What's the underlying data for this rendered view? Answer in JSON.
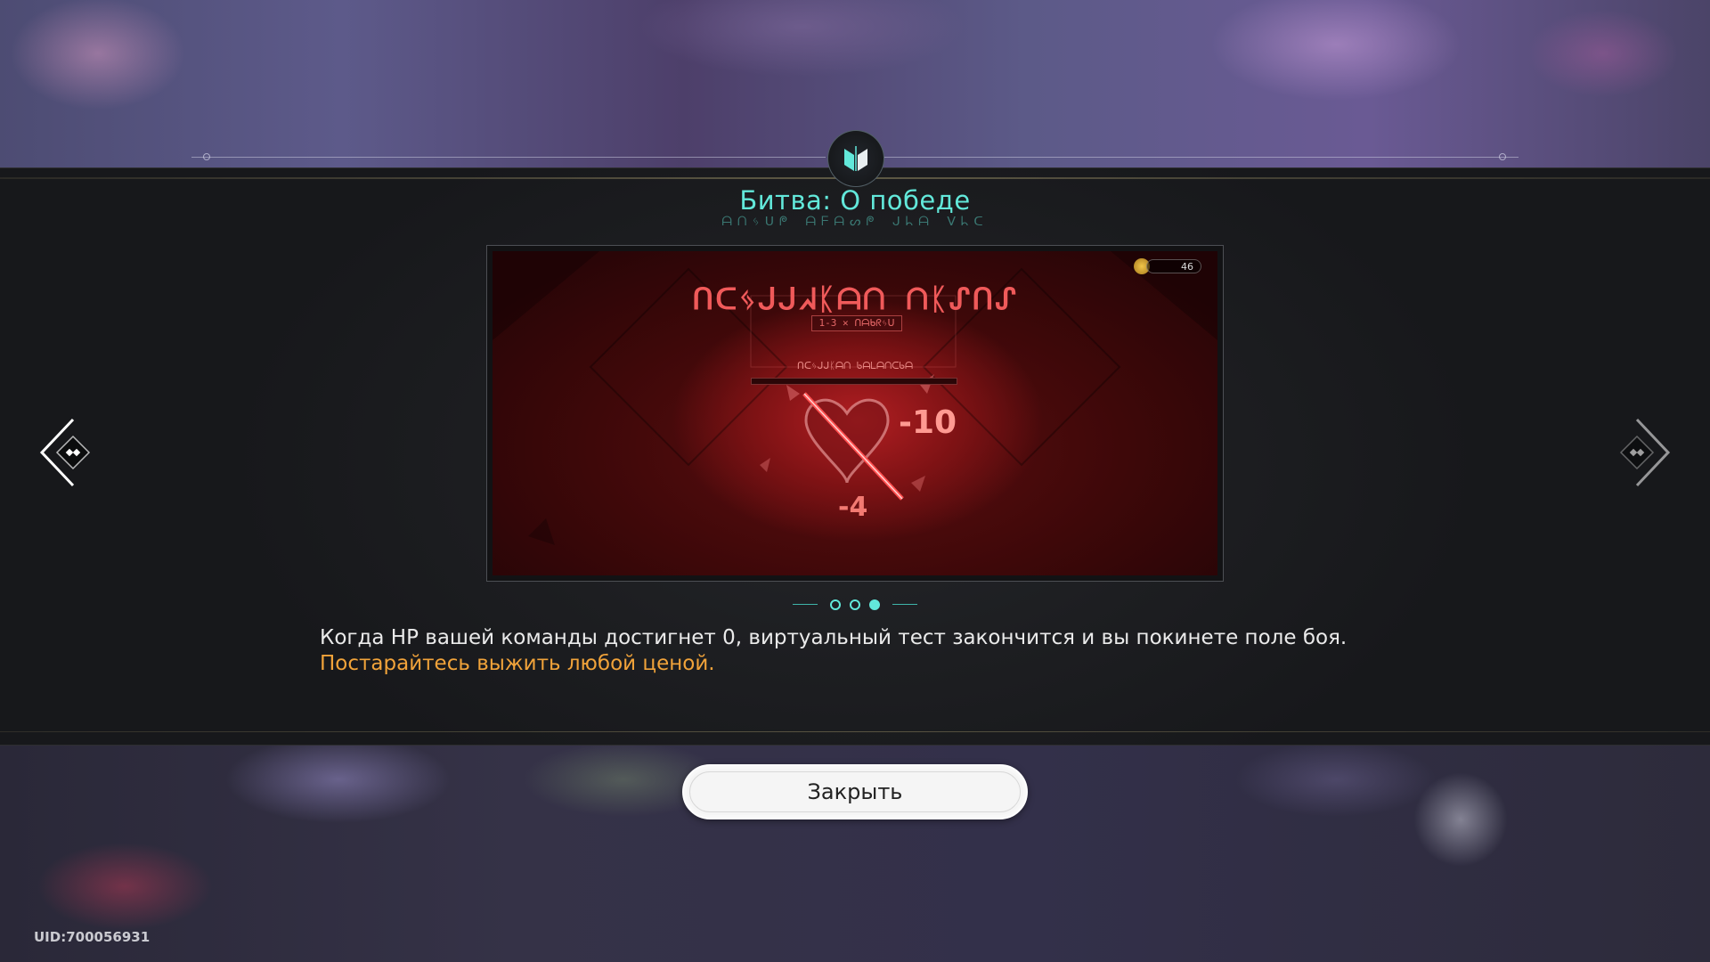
{
  "header": {
    "title": "Битва: О победе",
    "subtitle_glyphs": "ᗩᑎᛃᑌᖘ ᗩᖴᗩᔕᖘ ᒍᖺᗩ ᐯᖺᑕ"
  },
  "tutorial_image": {
    "scene_title": "ᑎᑕᛃᒍᒍᖽᛕᗩᑎ ᑎᛕᔑᑎᔑ",
    "stage_label": "1-3 ✕ ᑎᗩᑲᖇᛃᑌ",
    "scene_subtitle": "ᑎᑕᛃᒍᒍᛕᗩᑎ ᑲᗩᒪᗩᑎᑕᑲᗩ",
    "counter_value": "46",
    "damage_large": "-10",
    "damage_small": "-4"
  },
  "pager": {
    "total": 3,
    "current": 3
  },
  "description": {
    "main": "Когда HP вашей команды достигнет 0, виртуальный тест закончится и вы покинете поле боя.",
    "highlight": "Постарайтесь выжить любой ценой."
  },
  "buttons": {
    "close_label": "Закрыть"
  },
  "footer": {
    "uid": "UID:700056931"
  },
  "colors": {
    "accent": "#62e8da",
    "highlight": "#f1a33a",
    "scene_red": "#b11e22"
  }
}
